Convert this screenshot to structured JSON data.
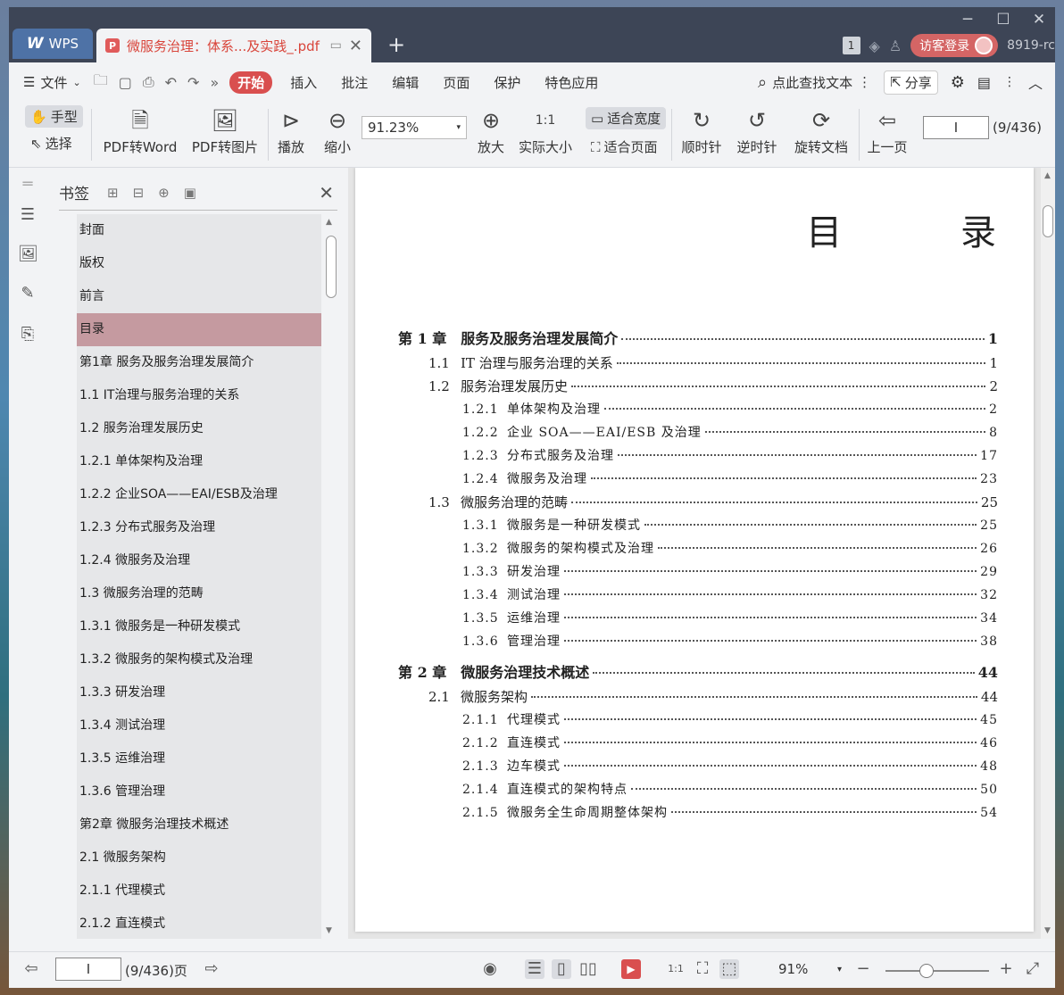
{
  "titlebar": {
    "wps_tab": "WPS",
    "doc_tab": "微服务治理：体系...及实践_.pdf",
    "pdf_icon_letter": "P",
    "page_badge": "1",
    "login": "访客登录",
    "user_code": "8919-rc"
  },
  "menu": {
    "file": "文件",
    "start": "开始",
    "items": [
      "插入",
      "批注",
      "编辑",
      "页面",
      "保护",
      "特色应用"
    ],
    "find": "点此查找文本",
    "share": "分享"
  },
  "toolbar": {
    "hand": "手型",
    "select": "选择",
    "pdf_to_word": "PDF转Word",
    "pdf_to_image": "PDF转图片",
    "play": "播放",
    "zoom_out": "缩小",
    "zoom_value": "91.23%",
    "zoom_in": "放大",
    "actual_size": "实际大小",
    "fit_width": "适合宽度",
    "fit_page": "适合页面",
    "clockwise": "顺时针",
    "counterclockwise": "逆时针",
    "rotate_doc": "旋转文档",
    "prev_page": "上一页",
    "page_input": "I",
    "page_total": "(9/436)"
  },
  "bookmarks": {
    "title": "书签",
    "items": [
      "封面",
      "版权",
      "前言",
      "目录",
      "第1章  服务及服务治理发展简介",
      "1.1  IT治理与服务治理的关系",
      "1.2  服务治理发展历史",
      "1.2.1  单体架构及治理",
      "1.2.2  企业SOA——EAI/ESB及治理",
      "1.2.3  分布式服务及治理",
      "1.2.4  微服务及治理",
      "1.3  微服务治理的范畴",
      "1.3.1  微服务是一种研发模式",
      "1.3.2  微服务的架构模式及治理",
      "1.3.3  研发治理",
      "1.3.4  测试治理",
      "1.3.5  运维治理",
      "1.3.6  管理治理",
      "第2章  微服务治理技术概述",
      "2.1  微服务架构",
      "2.1.1  代理模式",
      "2.1.2  直连模式"
    ],
    "selected_index": 3
  },
  "document": {
    "title": "目  录",
    "toc": [
      {
        "level": 1,
        "num": "第 1 章",
        "title": "服务及服务治理发展简介",
        "page": "1"
      },
      {
        "level": 2,
        "num": "1.1",
        "title": "IT 治理与服务治理的关系",
        "page": "1"
      },
      {
        "level": 2,
        "num": "1.2",
        "title": "服务治理发展历史",
        "page": "2"
      },
      {
        "level": 3,
        "num": "1.2.1",
        "title": "单体架构及治理",
        "page": "2"
      },
      {
        "level": 3,
        "num": "1.2.2",
        "title": "企业 SOA——EAI/ESB 及治理",
        "page": "8"
      },
      {
        "level": 3,
        "num": "1.2.3",
        "title": "分布式服务及治理",
        "page": "17"
      },
      {
        "level": 3,
        "num": "1.2.4",
        "title": "微服务及治理",
        "page": "23"
      },
      {
        "level": 2,
        "num": "1.3",
        "title": "微服务治理的范畴",
        "page": "25"
      },
      {
        "level": 3,
        "num": "1.3.1",
        "title": "微服务是一种研发模式",
        "page": "25"
      },
      {
        "level": 3,
        "num": "1.3.2",
        "title": "微服务的架构模式及治理",
        "page": "26"
      },
      {
        "level": 3,
        "num": "1.3.3",
        "title": "研发治理",
        "page": "29"
      },
      {
        "level": 3,
        "num": "1.3.4",
        "title": "测试治理",
        "page": "32"
      },
      {
        "level": 3,
        "num": "1.3.5",
        "title": "运维治理",
        "page": "34"
      },
      {
        "level": 3,
        "num": "1.3.6",
        "title": "管理治理",
        "page": "38"
      },
      {
        "level": 1,
        "num": "第 2 章",
        "title": "微服务治理技术概述",
        "page": "44"
      },
      {
        "level": 2,
        "num": "2.1",
        "title": "微服务架构",
        "page": "44"
      },
      {
        "level": 3,
        "num": "2.1.1",
        "title": "代理模式",
        "page": "45"
      },
      {
        "level": 3,
        "num": "2.1.2",
        "title": "直连模式",
        "page": "46"
      },
      {
        "level": 3,
        "num": "2.1.3",
        "title": "边车模式",
        "page": "48"
      },
      {
        "level": 3,
        "num": "2.1.4",
        "title": "直连模式的架构特点",
        "page": "50"
      },
      {
        "level": 3,
        "num": "2.1.5",
        "title": "微服务全生命周期整体架构",
        "page": "54"
      }
    ]
  },
  "status": {
    "page_input": "I",
    "page_label": "(9/436)页",
    "zoom": "91%",
    "zoom_level_percent": 91
  },
  "colors": {
    "accent_red": "#d94f4f",
    "selected_bookmark": "#c59aa0",
    "titlebar": "#3d4556"
  }
}
